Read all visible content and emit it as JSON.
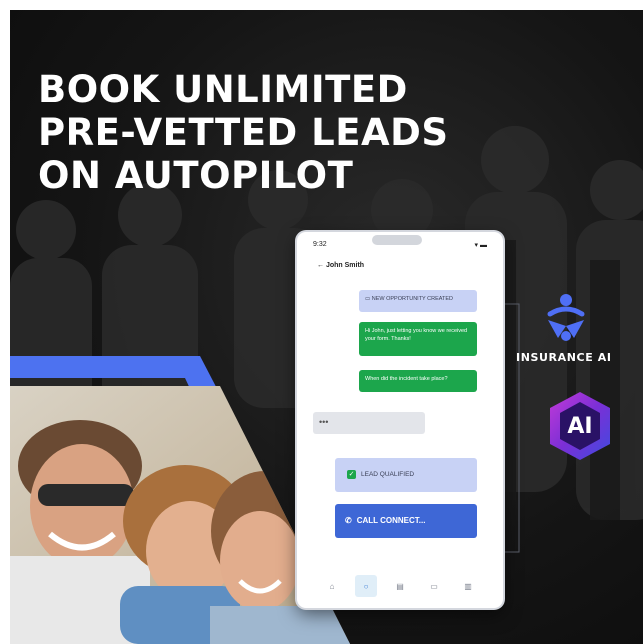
{
  "headline": {
    "line1": "BOOK UNLIMITED",
    "line2": "PRE-VETTED LEADS",
    "line3": "ON AUTOPILOT"
  },
  "phone": {
    "status_time": "9:32",
    "contact_name": "← John Smith",
    "messages": [
      {
        "text": "NEW OPPORTUNITY CREATED"
      },
      {
        "text": "Hi John, just letting you know we received your form. Thanks!"
      },
      {
        "text": "When did the incident take place?"
      },
      {
        "text": "•••"
      },
      {
        "text": "LEAD QUALIFIED"
      },
      {
        "text": "CALL CONNECT..."
      }
    ],
    "tabs": [
      "home-icon",
      "search-icon",
      "contacts-icon",
      "calendar-icon",
      "stats-icon"
    ]
  },
  "brand": {
    "name": "INSURANCE AI",
    "badge_text": "AI"
  },
  "colors": {
    "accent_blue": "#3e67d6",
    "bubble_blue": "#c8d2f5",
    "bubble_green": "#1ca64c",
    "stripe_blue": "#4d72f0",
    "logo_blue": "#4f6ff5",
    "badge_purple": "#7b2fd6"
  }
}
